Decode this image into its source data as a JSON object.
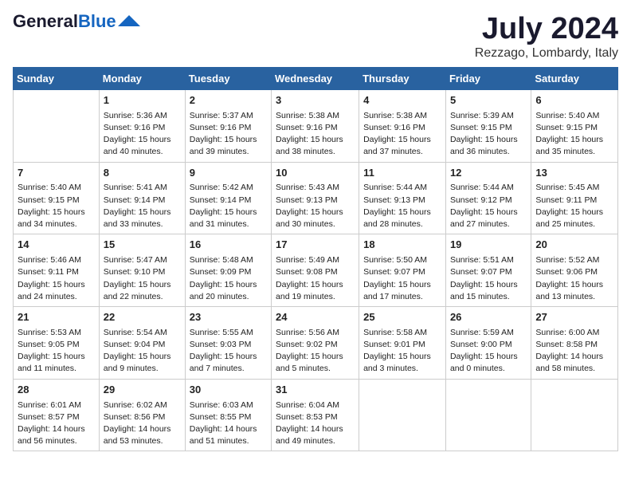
{
  "header": {
    "logo_general": "General",
    "logo_blue": "Blue",
    "month_year": "July 2024",
    "location": "Rezzago, Lombardy, Italy"
  },
  "days_of_week": [
    "Sunday",
    "Monday",
    "Tuesday",
    "Wednesday",
    "Thursday",
    "Friday",
    "Saturday"
  ],
  "weeks": [
    [
      {
        "date": "",
        "content": ""
      },
      {
        "date": "1",
        "content": "Sunrise: 5:36 AM\nSunset: 9:16 PM\nDaylight: 15 hours\nand 40 minutes."
      },
      {
        "date": "2",
        "content": "Sunrise: 5:37 AM\nSunset: 9:16 PM\nDaylight: 15 hours\nand 39 minutes."
      },
      {
        "date": "3",
        "content": "Sunrise: 5:38 AM\nSunset: 9:16 PM\nDaylight: 15 hours\nand 38 minutes."
      },
      {
        "date": "4",
        "content": "Sunrise: 5:38 AM\nSunset: 9:16 PM\nDaylight: 15 hours\nand 37 minutes."
      },
      {
        "date": "5",
        "content": "Sunrise: 5:39 AM\nSunset: 9:15 PM\nDaylight: 15 hours\nand 36 minutes."
      },
      {
        "date": "6",
        "content": "Sunrise: 5:40 AM\nSunset: 9:15 PM\nDaylight: 15 hours\nand 35 minutes."
      }
    ],
    [
      {
        "date": "7",
        "content": "Sunrise: 5:40 AM\nSunset: 9:15 PM\nDaylight: 15 hours\nand 34 minutes."
      },
      {
        "date": "8",
        "content": "Sunrise: 5:41 AM\nSunset: 9:14 PM\nDaylight: 15 hours\nand 33 minutes."
      },
      {
        "date": "9",
        "content": "Sunrise: 5:42 AM\nSunset: 9:14 PM\nDaylight: 15 hours\nand 31 minutes."
      },
      {
        "date": "10",
        "content": "Sunrise: 5:43 AM\nSunset: 9:13 PM\nDaylight: 15 hours\nand 30 minutes."
      },
      {
        "date": "11",
        "content": "Sunrise: 5:44 AM\nSunset: 9:13 PM\nDaylight: 15 hours\nand 28 minutes."
      },
      {
        "date": "12",
        "content": "Sunrise: 5:44 AM\nSunset: 9:12 PM\nDaylight: 15 hours\nand 27 minutes."
      },
      {
        "date": "13",
        "content": "Sunrise: 5:45 AM\nSunset: 9:11 PM\nDaylight: 15 hours\nand 25 minutes."
      }
    ],
    [
      {
        "date": "14",
        "content": "Sunrise: 5:46 AM\nSunset: 9:11 PM\nDaylight: 15 hours\nand 24 minutes."
      },
      {
        "date": "15",
        "content": "Sunrise: 5:47 AM\nSunset: 9:10 PM\nDaylight: 15 hours\nand 22 minutes."
      },
      {
        "date": "16",
        "content": "Sunrise: 5:48 AM\nSunset: 9:09 PM\nDaylight: 15 hours\nand 20 minutes."
      },
      {
        "date": "17",
        "content": "Sunrise: 5:49 AM\nSunset: 9:08 PM\nDaylight: 15 hours\nand 19 minutes."
      },
      {
        "date": "18",
        "content": "Sunrise: 5:50 AM\nSunset: 9:07 PM\nDaylight: 15 hours\nand 17 minutes."
      },
      {
        "date": "19",
        "content": "Sunrise: 5:51 AM\nSunset: 9:07 PM\nDaylight: 15 hours\nand 15 minutes."
      },
      {
        "date": "20",
        "content": "Sunrise: 5:52 AM\nSunset: 9:06 PM\nDaylight: 15 hours\nand 13 minutes."
      }
    ],
    [
      {
        "date": "21",
        "content": "Sunrise: 5:53 AM\nSunset: 9:05 PM\nDaylight: 15 hours\nand 11 minutes."
      },
      {
        "date": "22",
        "content": "Sunrise: 5:54 AM\nSunset: 9:04 PM\nDaylight: 15 hours\nand 9 minutes."
      },
      {
        "date": "23",
        "content": "Sunrise: 5:55 AM\nSunset: 9:03 PM\nDaylight: 15 hours\nand 7 minutes."
      },
      {
        "date": "24",
        "content": "Sunrise: 5:56 AM\nSunset: 9:02 PM\nDaylight: 15 hours\nand 5 minutes."
      },
      {
        "date": "25",
        "content": "Sunrise: 5:58 AM\nSunset: 9:01 PM\nDaylight: 15 hours\nand 3 minutes."
      },
      {
        "date": "26",
        "content": "Sunrise: 5:59 AM\nSunset: 9:00 PM\nDaylight: 15 hours\nand 0 minutes."
      },
      {
        "date": "27",
        "content": "Sunrise: 6:00 AM\nSunset: 8:58 PM\nDaylight: 14 hours\nand 58 minutes."
      }
    ],
    [
      {
        "date": "28",
        "content": "Sunrise: 6:01 AM\nSunset: 8:57 PM\nDaylight: 14 hours\nand 56 minutes."
      },
      {
        "date": "29",
        "content": "Sunrise: 6:02 AM\nSunset: 8:56 PM\nDaylight: 14 hours\nand 53 minutes."
      },
      {
        "date": "30",
        "content": "Sunrise: 6:03 AM\nSunset: 8:55 PM\nDaylight: 14 hours\nand 51 minutes."
      },
      {
        "date": "31",
        "content": "Sunrise: 6:04 AM\nSunset: 8:53 PM\nDaylight: 14 hours\nand 49 minutes."
      },
      {
        "date": "",
        "content": ""
      },
      {
        "date": "",
        "content": ""
      },
      {
        "date": "",
        "content": ""
      }
    ]
  ]
}
